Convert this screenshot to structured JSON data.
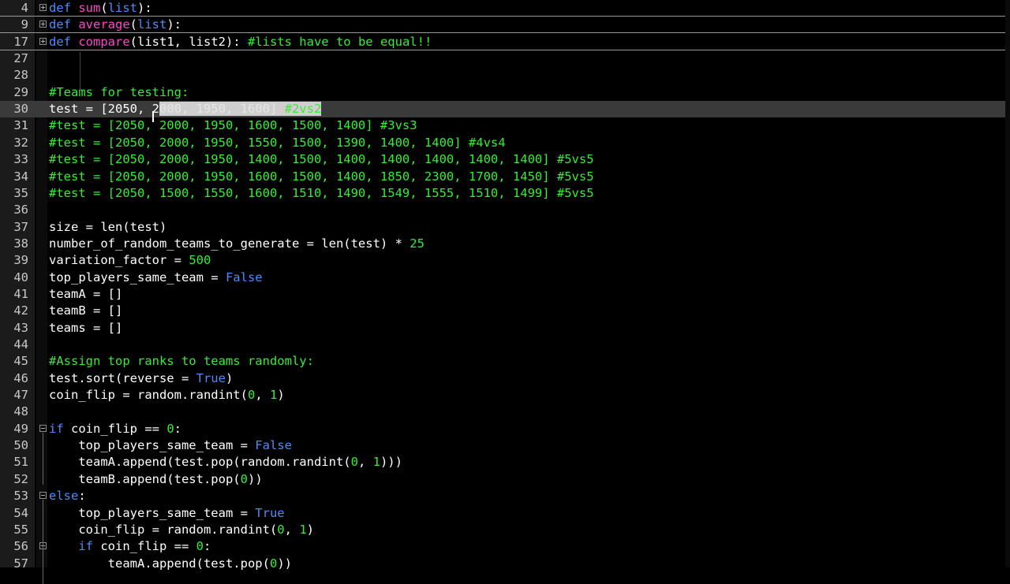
{
  "editor": {
    "theme_colors": {
      "background": "#000000",
      "text": "#ffffff",
      "keyword": "#4a8cff",
      "function_name": "#ff44cc",
      "comment": "#33ee33",
      "number": "#33ee33",
      "current_line": "#3a3a3a"
    },
    "lines": [
      {
        "num": "4",
        "fold": "plus",
        "spans": [
          {
            "t": "def",
            "c": "kw"
          },
          {
            "t": " ",
            "c": "pl"
          },
          {
            "t": "sum",
            "c": "fn"
          },
          {
            "t": "(",
            "c": "pl"
          },
          {
            "t": "list",
            "c": "kw"
          },
          {
            "t": "):",
            "c": "pl"
          }
        ]
      },
      {
        "num": "9",
        "fold": "plus",
        "spans": [
          {
            "t": "def",
            "c": "kw"
          },
          {
            "t": " ",
            "c": "pl"
          },
          {
            "t": "average",
            "c": "fn"
          },
          {
            "t": "(",
            "c": "pl"
          },
          {
            "t": "list",
            "c": "kw"
          },
          {
            "t": "):",
            "c": "pl"
          }
        ]
      },
      {
        "num": "17",
        "fold": "plus",
        "spans": [
          {
            "t": "def",
            "c": "kw"
          },
          {
            "t": " ",
            "c": "pl"
          },
          {
            "t": "compare",
            "c": "fn"
          },
          {
            "t": "(list1, list2): ",
            "c": "pl"
          },
          {
            "t": "#lists have to be equal!!",
            "c": "cm"
          }
        ]
      },
      {
        "num": "27",
        "spans": []
      },
      {
        "num": "28",
        "spans": []
      },
      {
        "num": "29",
        "spans": [
          {
            "t": "#Teams for testing:",
            "c": "cm"
          }
        ]
      },
      {
        "num": "30",
        "current": true,
        "spans": [
          {
            "t": "test = [2050, 2",
            "c": "pl"
          },
          {
            "t": "000, 1950, 1600] ",
            "c": "sel"
          },
          {
            "t": "#2vs2",
            "c": "selc"
          }
        ]
      },
      {
        "num": "31",
        "spans": [
          {
            "t": "#test = [2050, 2000, 1950, 1600, 1500, 1400] #3vs3",
            "c": "cm"
          }
        ]
      },
      {
        "num": "32",
        "spans": [
          {
            "t": "#test = [2050, 2000, 1950, 1550, 1500, 1390, 1400, 1400] #4vs4",
            "c": "cm"
          }
        ]
      },
      {
        "num": "33",
        "spans": [
          {
            "t": "#test = [2050, 2000, 1950, 1400, 1500, 1400, 1400, 1400, 1400, 1400] #5vs5",
            "c": "cm"
          }
        ]
      },
      {
        "num": "34",
        "spans": [
          {
            "t": "#test = [2050, 2000, 1950, 1600, 1500, 1400, 1850, 2300, 1700, 1450] #5vs5",
            "c": "cm"
          }
        ]
      },
      {
        "num": "35",
        "spans": [
          {
            "t": "#test = [2050, 1500, 1550, 1600, 1510, 1490, 1549, 1555, 1510, 1499] #5vs5",
            "c": "cm"
          }
        ]
      },
      {
        "num": "36",
        "spans": []
      },
      {
        "num": "37",
        "spans": [
          {
            "t": "size = len(test)",
            "c": "pl"
          }
        ]
      },
      {
        "num": "38",
        "spans": [
          {
            "t": "number_of_random_teams_to_generate = len(test) * ",
            "c": "pl"
          },
          {
            "t": "25",
            "c": "nm"
          }
        ]
      },
      {
        "num": "39",
        "spans": [
          {
            "t": "variation_factor = ",
            "c": "pl"
          },
          {
            "t": "500",
            "c": "nm"
          }
        ]
      },
      {
        "num": "40",
        "spans": [
          {
            "t": "top_players_same_team = ",
            "c": "pl"
          },
          {
            "t": "False",
            "c": "kw"
          }
        ]
      },
      {
        "num": "41",
        "spans": [
          {
            "t": "teamA = []",
            "c": "pl"
          }
        ]
      },
      {
        "num": "42",
        "spans": [
          {
            "t": "teamB = []",
            "c": "pl"
          }
        ]
      },
      {
        "num": "43",
        "spans": [
          {
            "t": "teams = []",
            "c": "pl"
          }
        ]
      },
      {
        "num": "44",
        "spans": []
      },
      {
        "num": "45",
        "spans": [
          {
            "t": "#Assign top ranks to teams randomly:",
            "c": "cm"
          }
        ]
      },
      {
        "num": "46",
        "spans": [
          {
            "t": "test.sort(reverse = ",
            "c": "pl"
          },
          {
            "t": "True",
            "c": "kw"
          },
          {
            "t": ")",
            "c": "pl"
          }
        ]
      },
      {
        "num": "47",
        "spans": [
          {
            "t": "coin_flip = random.randint(",
            "c": "pl"
          },
          {
            "t": "0",
            "c": "nm"
          },
          {
            "t": ", ",
            "c": "pl"
          },
          {
            "t": "1",
            "c": "nm"
          },
          {
            "t": ")",
            "c": "pl"
          }
        ]
      },
      {
        "num": "48",
        "spans": []
      },
      {
        "num": "49",
        "fold": "minus",
        "spans": [
          {
            "t": "if",
            "c": "kw"
          },
          {
            "t": " coin_flip == ",
            "c": "pl"
          },
          {
            "t": "0",
            "c": "nm"
          },
          {
            "t": ":",
            "c": "pl"
          }
        ]
      },
      {
        "num": "50",
        "spans": [
          {
            "t": "    top_players_same_team = ",
            "c": "pl"
          },
          {
            "t": "False",
            "c": "kw"
          }
        ]
      },
      {
        "num": "51",
        "spans": [
          {
            "t": "    teamA.append(test.pop(random.randint(",
            "c": "pl"
          },
          {
            "t": "0",
            "c": "nm"
          },
          {
            "t": ", ",
            "c": "pl"
          },
          {
            "t": "1",
            "c": "nm"
          },
          {
            "t": ")))",
            "c": "pl"
          }
        ]
      },
      {
        "num": "52",
        "spans": [
          {
            "t": "    teamB.append(test.pop(",
            "c": "pl"
          },
          {
            "t": "0",
            "c": "nm"
          },
          {
            "t": "))",
            "c": "pl"
          }
        ]
      },
      {
        "num": "53",
        "fold": "minus",
        "spans": [
          {
            "t": "else",
            "c": "kw"
          },
          {
            "t": ":",
            "c": "pl"
          }
        ]
      },
      {
        "num": "54",
        "spans": [
          {
            "t": "    top_players_same_team = ",
            "c": "pl"
          },
          {
            "t": "True",
            "c": "kw"
          }
        ]
      },
      {
        "num": "55",
        "spans": [
          {
            "t": "    coin_flip = random.randint(",
            "c": "pl"
          },
          {
            "t": "0",
            "c": "nm"
          },
          {
            "t": ", ",
            "c": "pl"
          },
          {
            "t": "1",
            "c": "nm"
          },
          {
            "t": ")",
            "c": "pl"
          }
        ]
      },
      {
        "num": "56",
        "fold": "minus",
        "spans": [
          {
            "t": "    ",
            "c": "pl"
          },
          {
            "t": "if",
            "c": "kw"
          },
          {
            "t": " coin_flip == ",
            "c": "pl"
          },
          {
            "t": "0",
            "c": "nm"
          },
          {
            "t": ":",
            "c": "pl"
          }
        ]
      },
      {
        "num": "57",
        "spans": [
          {
            "t": "        teamA.append(test.pop(",
            "c": "pl"
          },
          {
            "t": "0",
            "c": "nm"
          },
          {
            "t": "))",
            "c": "pl"
          }
        ]
      }
    ]
  }
}
